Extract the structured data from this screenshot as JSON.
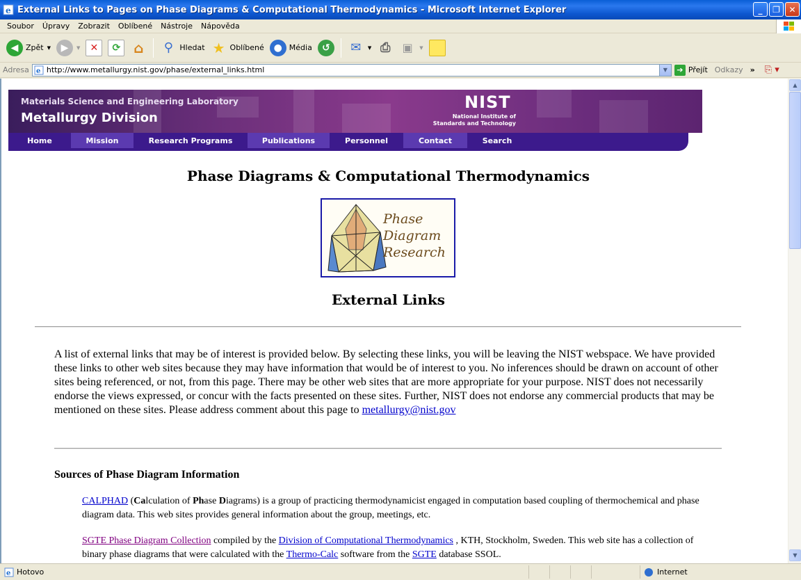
{
  "window": {
    "title": "External Links to Pages on Phase Diagrams & Computational Thermodynamics - Microsoft Internet Explorer",
    "minimize": "_",
    "maximize": "❐",
    "close": "✕"
  },
  "menu": [
    "Soubor",
    "Úpravy",
    "Zobrazit",
    "Oblíbené",
    "Nástroje",
    "Nápověda"
  ],
  "toolbar": {
    "back_label": "Zpět",
    "search_label": "Hledat",
    "favorites_label": "Oblíbené",
    "media_label": "Média"
  },
  "address": {
    "label": "Adresa",
    "url": "http://www.metallurgy.nist.gov/phase/external_links.html",
    "go_label": "Přejít",
    "links_label": "Odkazy",
    "more": "»"
  },
  "banner": {
    "lab": "Materials Science and Engineering Laboratory",
    "division": "Metallurgy Division",
    "nist": "NIST",
    "nist_sub_1": "National Institute of",
    "nist_sub_2": "Standards and Technology"
  },
  "nav": [
    "Home",
    "Mission",
    "Research Programs",
    "Publications",
    "Personnel",
    "Contact",
    "Search"
  ],
  "page": {
    "title": "Phase Diagrams & Computational Thermodynamics",
    "logo_line1": "Phase",
    "logo_line2": "Diagram",
    "logo_line3": "Research",
    "subtitle": "External Links",
    "intro": "A list of external links that may be of interest is provided below. By selecting these links, you will be leaving the NIST webspace. We have provided these links to other web sites because they may have information that would be of interest to you. No inferences should be drawn on account of other sites being referenced, or not, from this page. There may be other web sites that are more appropriate for your purpose. NIST does not necessarily endorse the views expressed, or concur with the facts presented on these sites. Further, NIST does not endorse any commercial products that may be mentioned on these sites. Please address comment about this page to",
    "email": "metallurgy@nist.gov",
    "section_heading": "Sources of Phase Diagram Information",
    "calphad_link": "CALPHAD",
    "calphad_open": " (",
    "calphad_ca": "Ca",
    "calphad_lculation": "lculation of ",
    "calphad_ph": "Ph",
    "calphad_ase": "ase ",
    "calphad_d": "D",
    "calphad_iagrams": "iagrams",
    "calphad_rest": ") is a group of practicing thermodynamicist engaged in computation based coupling of thermochemical and phase diagram data. This web sites provides general information about the group, meetings, etc.",
    "sgte_link": "SGTE Phase Diagram Collection",
    "sgte_mid": " compiled by the ",
    "dct_link": "Division of Computational Thermodynamics",
    "sgte_mid2": " , KTH, Stockholm, Sweden. This web site has a collection of binary phase diagrams that were calculated with the ",
    "thermocalc_link": "Thermo-Calc",
    "sgte_mid3": " software from the ",
    "sgte2_link": "SGTE",
    "sgte_end": " database SSOL."
  },
  "status": {
    "text": "Hotovo",
    "zone": "Internet"
  },
  "colors": {
    "titlebar": "#0a5fd6",
    "link": "#0000cc",
    "visited": "#800080",
    "nav_bg": "#3c1a8c",
    "banner": "#6b2f7a"
  }
}
